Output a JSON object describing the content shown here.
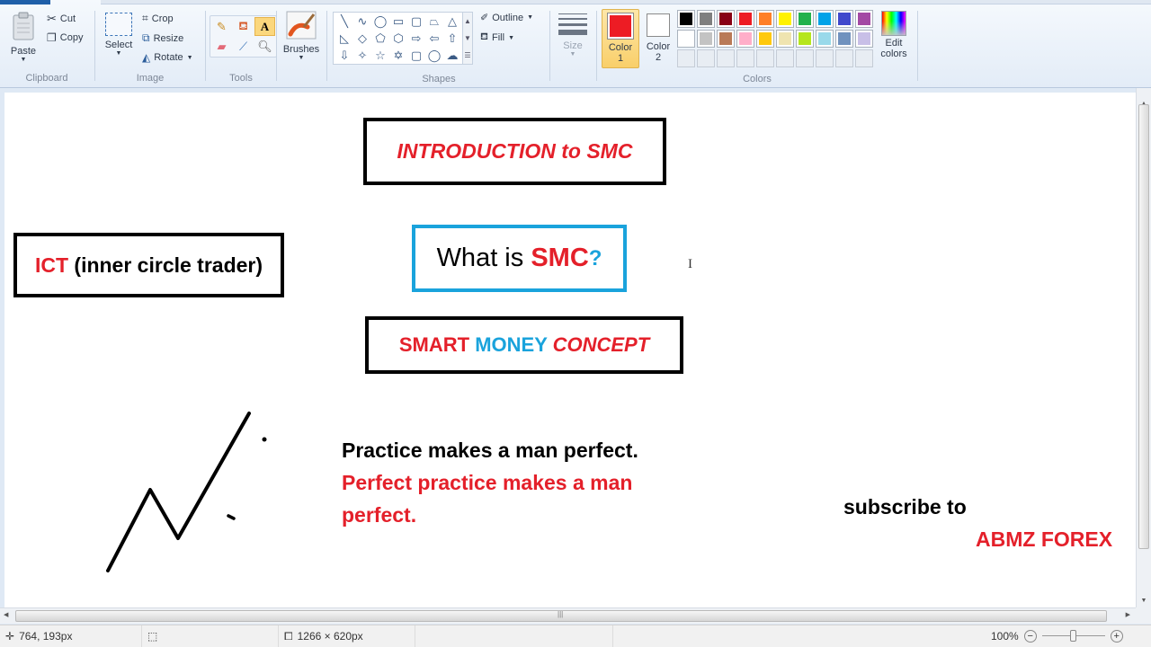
{
  "ribbon": {
    "clipboard": {
      "group_label": "Clipboard",
      "paste": "Paste",
      "cut": "Cut",
      "copy": "Copy"
    },
    "image": {
      "group_label": "Image",
      "select": "Select",
      "crop": "Crop",
      "resize": "Resize",
      "rotate": "Rotate"
    },
    "tools": {
      "group_label": "Tools",
      "items": [
        "pencil",
        "fill",
        "text",
        "eraser",
        "color-picker",
        "magnifier"
      ],
      "active": "text",
      "text_glyph": "A"
    },
    "brushes": {
      "label": "Brushes"
    },
    "shapes": {
      "group_label": "Shapes",
      "items": [
        "line",
        "curve",
        "oval",
        "rectangle",
        "rounded-rectangle",
        "polygon",
        "triangle",
        "right-triangle",
        "diamond",
        "pentagon",
        "hexagon",
        "right-arrow",
        "left-arrow",
        "up-arrow",
        "down-arrow",
        "four-point-star",
        "five-point-star",
        "six-point-star",
        "rounded-callout",
        "oval-callout",
        "cloud-callout"
      ],
      "glyphs": [
        "╲",
        "∿",
        "◯",
        "▭",
        "▢",
        "⏢",
        "△",
        "◺",
        "◇",
        "⬠",
        "⬡",
        "⇨",
        "⇦",
        "⇧",
        "⇩",
        "✧",
        "☆",
        "✡",
        "▢",
        "◯",
        "☁"
      ],
      "outline": "Outline",
      "fill": "Fill"
    },
    "size": {
      "label": "Size"
    },
    "color1": {
      "label_line1": "Color",
      "label_line2": "1",
      "value": "#ed1c24"
    },
    "color2": {
      "label_line1": "Color",
      "label_line2": "2",
      "value": "#ffffff"
    },
    "colors": {
      "group_label": "Colors",
      "row1": [
        "#000000",
        "#7f7f7f",
        "#880015",
        "#ed1c24",
        "#ff7f27",
        "#fff200",
        "#22b14c",
        "#00a2e8",
        "#3f48cc",
        "#a349a4"
      ],
      "row2": [
        "#ffffff",
        "#c3c3c3",
        "#b97a57",
        "#ffaec9",
        "#ffc90e",
        "#efe4b0",
        "#b5e61d",
        "#99d9ea",
        "#7092be",
        "#c8bfe7"
      ],
      "row3_empty_count": 10,
      "edit_colors_line1": "Edit",
      "edit_colors_line2": "colors"
    }
  },
  "canvas": {
    "intro": {
      "text1": "INTRODUCTION to SMC"
    },
    "ict": {
      "red": "ICT",
      "black": " (inner circle trader)"
    },
    "what": {
      "black": "What is ",
      "red": "SMC",
      "blue": "?"
    },
    "smc": {
      "red1": "SMART ",
      "blue": "MONEY ",
      "red2": "CONCEPT"
    },
    "quote": {
      "line1": "Practice makes a man perfect.",
      "line2": "Perfect practice makes a man",
      "line3": "perfect."
    },
    "subscribe": {
      "line1": "subscribe to",
      "line2": "ABMZ FOREX"
    },
    "colors": {
      "red": "#e4202a",
      "blue": "#1aa3dc",
      "black": "#000000"
    }
  },
  "statusbar": {
    "cursor_position": "764, 193px",
    "selection_size": "",
    "image_size": "1266 × 620px",
    "zoom": "100%",
    "zoom_level_percent": 100
  }
}
